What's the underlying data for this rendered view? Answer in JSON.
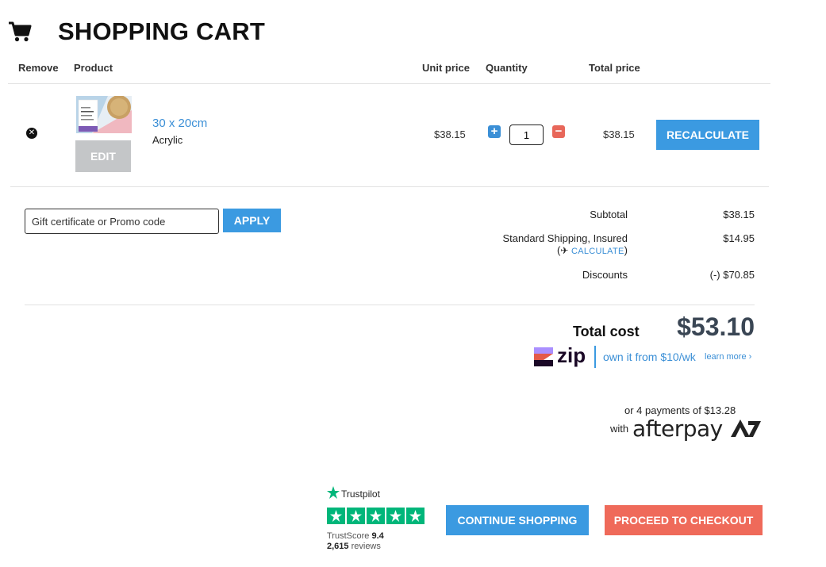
{
  "header": {
    "icon": "shopping-cart-icon",
    "title": "SHOPPING CART"
  },
  "table_headers": {
    "remove": "Remove",
    "product": "Product",
    "unit_price": "Unit price",
    "quantity": "Quantity",
    "total_price": "Total price"
  },
  "item": {
    "remove_icon": "close-icon",
    "size": "30 x 20cm",
    "material": "Acrylic",
    "edit_label": "EDIT",
    "unit_price": "$38.15",
    "quantity": "1",
    "plus_icon": "plus-icon",
    "minus_icon": "minus-icon",
    "total": "$38.15",
    "recalculate_label": "RECALCULATE"
  },
  "promo": {
    "placeholder": "Gift certificate or Promo code",
    "apply_label": "APPLY"
  },
  "summary": {
    "subtotal_label": "Subtotal",
    "subtotal_value": "$38.15",
    "shipping_label": "Standard Shipping, Insured",
    "shipping_value": "$14.95",
    "calculate_open": "(",
    "calculate_label": "CALCULATE",
    "calculate_close": ")",
    "plane_icon": "airplane-icon",
    "discounts_label": "Discounts",
    "discounts_value": "(-) $70.85",
    "total_label": "Total cost",
    "total_value": "$53.10"
  },
  "zip": {
    "logo_text": "zip",
    "text": "own it from $10/wk",
    "learn_more": "learn more ›",
    "brand_color": "#3b9ae1"
  },
  "afterpay": {
    "payments_text": "or 4 payments of $13.28",
    "with_text": "with",
    "logo_text": "afterpay"
  },
  "trustpilot": {
    "name": "Trustpilot",
    "stars": 5,
    "score_label": "TrustScore",
    "score": "9.4",
    "reviews_count": "2,615",
    "reviews_label": "reviews",
    "star_color": "#00b67a"
  },
  "actions": {
    "continue_label": "CONTINUE SHOPPING",
    "checkout_label": "PROCEED TO CHECKOUT"
  },
  "colors": {
    "primary_blue": "#3b9ae1",
    "checkout_red": "#ef6a5a",
    "edit_gray": "#c4c6c8"
  }
}
